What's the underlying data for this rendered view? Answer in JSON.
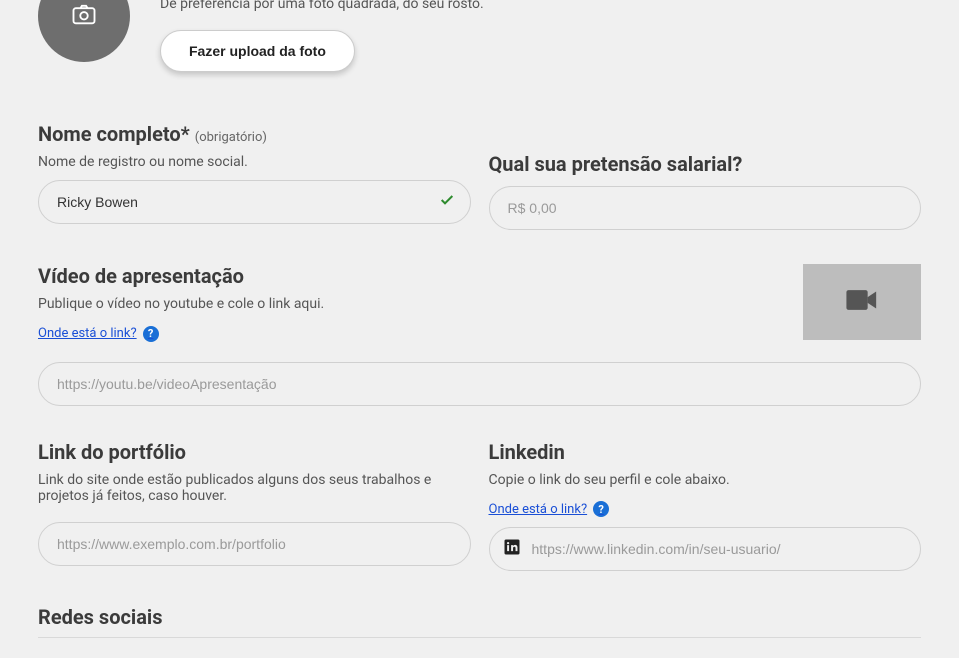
{
  "photo": {
    "hint": "Dê preferência por uma foto quadrada, do seu rosto.",
    "upload_label": "Fazer upload da foto"
  },
  "name": {
    "title": "Nome completo*",
    "required": "(obrigatório)",
    "subtext": "Nome de registro ou nome social.",
    "value": "Ricky Bowen"
  },
  "salary": {
    "title": "Qual sua pretensão salarial?",
    "placeholder": "R$ 0,00"
  },
  "video": {
    "title": "Vídeo de apresentação",
    "subtext": "Publique o vídeo no youtube e cole o link aqui.",
    "help_label": "Onde está o link?",
    "placeholder": "https://youtu.be/videoApresentação"
  },
  "portfolio": {
    "title": "Link do portfólio",
    "subtext": "Link do site onde estão publicados alguns dos seus trabalhos e projetos já feitos, caso houver.",
    "placeholder": "https://www.exemplo.com.br/portfolio"
  },
  "linkedin": {
    "title": "Linkedin",
    "subtext": "Copie o link do seu perfil e cole abaixo.",
    "help_label": "Onde está o link?",
    "placeholder": "https://www.linkedin.com/in/seu-usuario/"
  },
  "social": {
    "title": "Redes sociais"
  }
}
